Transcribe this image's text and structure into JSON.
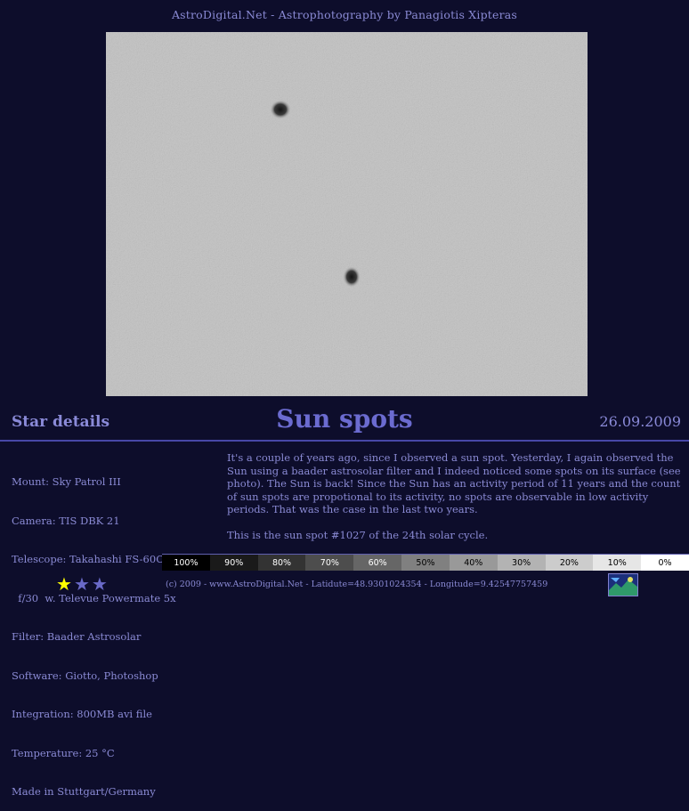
{
  "header": {
    "site_title": "AstroDigital.Net - Astrophotography by Panagiotis Xipteras"
  },
  "photo": {
    "title": "Sun spots",
    "date": "26.09.2009"
  },
  "star_details": {
    "heading": "Star details",
    "lines": [
      "Mount: Sky Patrol III",
      "Camera: TIS DBK 21",
      "Telescope: Takahashi FS-60C",
      "  f/30  w. Televue Powermate 5x",
      "Filter: Baader Astrosolar",
      "Software: Giotto, Photoshop",
      "Integration: 800MB avi file",
      "Temperature: 25 °C",
      "Made in Stuttgart/Germany"
    ]
  },
  "description": {
    "paragraph1": "It's a couple of years ago, since I observed a sun spot. Yesterday, I again observed the Sun using a baader astrosolar filter and I indeed noticed some spots on its surface (see photo). The Sun is back! Since the Sun has an activity period of 11 years and the count of sun spots are propotional to its activity, no spots are observable in low activity periods. That was the case in the last two years.",
    "paragraph2": "This is the sun spot  #1027 of the 24th solar cycle."
  },
  "gray_scale": [
    {
      "label": "100%",
      "bg": "#000000",
      "fg": "#ffffff"
    },
    {
      "label": "90%",
      "bg": "#1a1a1a",
      "fg": "#ffffff"
    },
    {
      "label": "80%",
      "bg": "#333333",
      "fg": "#ffffff"
    },
    {
      "label": "70%",
      "bg": "#4d4d4d",
      "fg": "#ffffff"
    },
    {
      "label": "60%",
      "bg": "#666666",
      "fg": "#ffffff"
    },
    {
      "label": "50%",
      "bg": "#808080",
      "fg": "#000000"
    },
    {
      "label": "40%",
      "bg": "#999999",
      "fg": "#000000"
    },
    {
      "label": "30%",
      "bg": "#b3b3b3",
      "fg": "#000000"
    },
    {
      "label": "20%",
      "bg": "#cccccc",
      "fg": "#000000"
    },
    {
      "label": "10%",
      "bg": "#e6e6e6",
      "fg": "#000000"
    },
    {
      "label": "0%",
      "bg": "#ffffff",
      "fg": "#000000"
    }
  ],
  "rating": {
    "value": 1,
    "max": 3,
    "filled_color": "#ffff00",
    "empty_color": "#6a6ac8"
  },
  "footer": {
    "text": "(c) 2009 - www.AstroDigital.Net - Latidute=48.9301024354 - Longitude=9.42547757459",
    "logo_icon": "astrodigital-logo-icon"
  },
  "colors": {
    "background": "#0d0d2b",
    "accent": "#6b6bd0",
    "divider": "#4848a8"
  }
}
